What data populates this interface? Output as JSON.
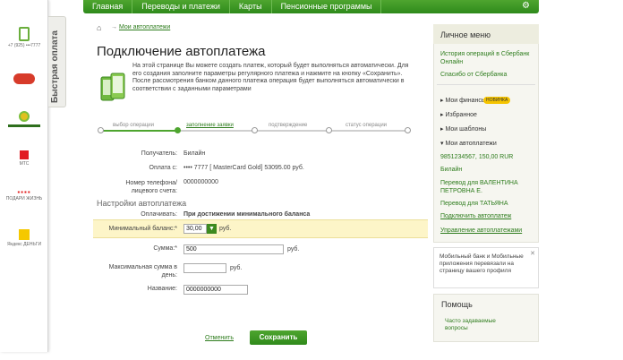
{
  "nav": {
    "items": [
      "Главная",
      "Переводы и платежи",
      "Карты",
      "Пенсионные программы"
    ],
    "settings_icon": "gear-icon"
  },
  "quickpay": {
    "tab_label": "Быстрая оплата",
    "items": [
      {
        "icon": "phone-icon",
        "label": "+7 (925) •••7777"
      },
      {
        "icon": "beeline-logo",
        "label": ""
      },
      {
        "icon": "sber-logo",
        "label": ""
      },
      {
        "icon": "mts-logo",
        "label": "МТС"
      },
      {
        "icon": "podari-zhizn-logo",
        "label": "ПОДАРИ ЖИЗНЬ"
      },
      {
        "icon": "yandex-dengi-logo",
        "label": "Яндекс ДЕНЬГИ"
      }
    ]
  },
  "breadcrumb": {
    "home_icon": "home-icon",
    "link": "Мои автоплатежи"
  },
  "page": {
    "title": "Подключение автоплатежа",
    "intro": "На этой странице Вы можете создать платеж, который будет выполняться автоматически. Для его создания заполните параметры регулярного платежа и нажмите на кнопку «Сохранить». После рассмотрения банком данного платежа операция будет выполняться автоматически в соответствии с заданными параметрами"
  },
  "progress": {
    "steps": [
      "выбор операции",
      "заполнение заявки",
      "подтверждение",
      "статус операции"
    ],
    "active_index": 1
  },
  "form": {
    "recipient_label": "Получатель:",
    "recipient_value": "Билайн",
    "pay_from_label": "Оплата с:",
    "pay_from_value": "•••• 7777 [ MasterCard Gold] 53095.00 руб.",
    "account_label": "Номер телефона/лицевого счета:",
    "account_value": "0000000000",
    "section_title": "Настройки автоплатежа",
    "pay_when_label": "Оплачивать:",
    "pay_when_value": "При достижении минимального баланса",
    "min_balance_label": "Минимальный баланс:*",
    "min_balance_value": "30,00",
    "min_balance_unit": "руб.",
    "amount_label": "Сумма:*",
    "amount_value": "500",
    "amount_unit": "руб.",
    "max_amount_label": "Максимальная сумма в день:",
    "max_amount_value": "",
    "max_amount_unit": "руб.",
    "name_label": "Название:",
    "name_value": "0000000000",
    "cancel_label": "Отменить",
    "save_label": "Сохранить"
  },
  "sidebar": {
    "title": "Личное меню",
    "links_top": [
      "История операций в Сбербанк Онлайн",
      "Спасибо от Сбербанка"
    ],
    "my_finance": "Мои финансы",
    "new_badge": "НОВИНКА",
    "favorites": "Избранное",
    "templates": "Мои шаблоны",
    "autopayments": "Мои автоплатежи",
    "auto_items": [
      "9851234567, 150,00 RUR",
      "Билайн",
      "Перевод для ВАЛЕНТИНА ПЕТРОВНА Е.",
      "Перевод для ТАТЬЯНА",
      "Подключить автоплатеж",
      "Управление автоплатежами"
    ],
    "note": "Мобильный банк и Мобильные приложения перевязали на страницу вашего профиля",
    "help_title": "Помощь",
    "help_link": "Часто задаваемые вопросы"
  },
  "colors": {
    "brand": "#2f8a1b",
    "accent_band": "#fdf5c8",
    "badge": "#f5c400"
  }
}
